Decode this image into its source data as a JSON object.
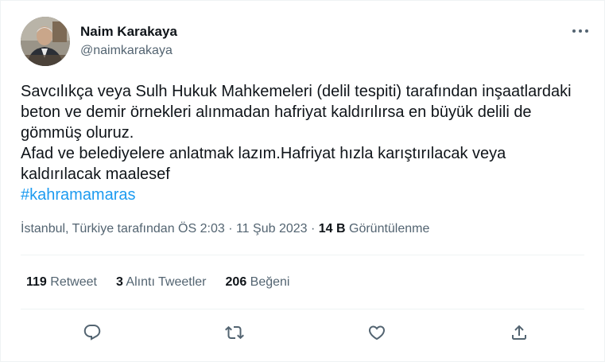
{
  "author": {
    "name": "Naim Karakaya",
    "handle": "@naimkarakaya"
  },
  "tweet": {
    "text": "Savcılıkça veya Sulh Hukuk Mahkemeleri (delil tespiti) tarafından inşaatlardaki beton ve demir örnekleri alınmadan hafriyat kaldırılırsa en büyük delili de gömmüş oluruz.\nAfad ve belediyelere anlatmak lazım.Hafriyat hızla karıştırılacak veya kaldırılacak maalesef",
    "hashtag": "#kahramamaras"
  },
  "meta": {
    "location_time": "İstanbul, Türkiye tarafından ÖS 2:03",
    "sep1": " · ",
    "date": "11 Şub 2023",
    "sep2": " · ",
    "views_count": "14 B",
    "views_label": " Görüntülenme"
  },
  "stats": {
    "retweets_count": "119",
    "retweets_label": " Retweet",
    "quotes_count": "3",
    "quotes_label": " Alıntı Tweetler",
    "likes_count": "206",
    "likes_label": " Beğeni"
  },
  "icons": [
    "more-icon",
    "reply-icon",
    "retweet-icon",
    "like-icon",
    "share-icon"
  ],
  "colors": {
    "accent": "#1d9bf0",
    "secondary_text": "#536471",
    "primary_text": "#0f1419",
    "divider": "#eff3f4"
  }
}
